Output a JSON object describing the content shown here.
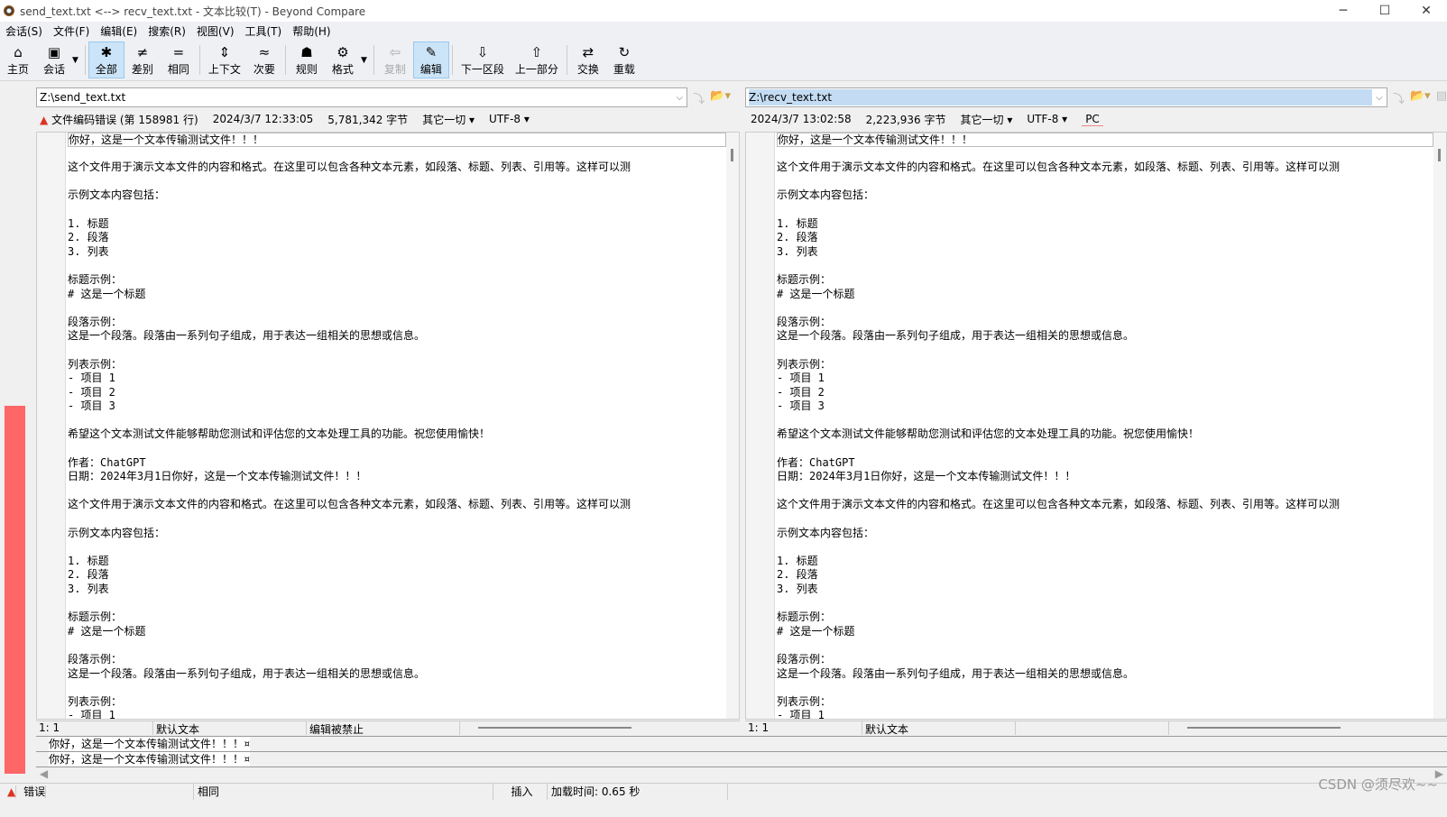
{
  "window": {
    "title": "send_text.txt <--> recv_text.txt - 文本比较(T) - Beyond Compare",
    "minimize": "─",
    "maximize": "☐",
    "close": "✕"
  },
  "menu": [
    "会话(S)",
    "文件(F)",
    "编辑(E)",
    "搜索(R)",
    "视图(V)",
    "工具(T)",
    "帮助(H)"
  ],
  "toolbar": [
    {
      "label": "主页",
      "icon": "⌂"
    },
    {
      "label": "会话",
      "icon": "▣"
    },
    {
      "label": "全部",
      "icon": "✱"
    },
    {
      "label": "差别",
      "icon": "≠"
    },
    {
      "label": "相同",
      "icon": "="
    },
    {
      "label": "上下文",
      "icon": "⇕"
    },
    {
      "label": "次要",
      "icon": "≈"
    },
    {
      "label": "规则",
      "icon": "☗"
    },
    {
      "label": "格式",
      "icon": "⚙"
    },
    {
      "label": "复制",
      "icon": "⇦"
    },
    {
      "label": "编辑",
      "icon": "✎"
    },
    {
      "label": "下一区段",
      "icon": "⇩"
    },
    {
      "label": "上一部分",
      "icon": "⇧"
    },
    {
      "label": "交换",
      "icon": "⇄"
    },
    {
      "label": "重载",
      "icon": "↻"
    }
  ],
  "left": {
    "path": "Z:\\send_text.txt",
    "error": "文件编码错误 (第 158981 行)",
    "date": "2024/3/7 12:33:05",
    "size": "5,781,342 字节",
    "filter": "其它一切",
    "encoding": "UTF-8",
    "status_pos": "1: 1",
    "status_format": "默认文本",
    "status_edit": "编辑被禁止"
  },
  "right": {
    "path": "Z:\\recv_text.txt",
    "date": "2024/3/7 13:02:58",
    "size": "2,223,936 字节",
    "filter": "其它一切",
    "encoding": "UTF-8",
    "lineend": "PC",
    "status_pos": "1: 1",
    "status_format": "默认文本"
  },
  "lines": [
    "你好，这是一个文本传输测试文件！！！",
    "",
    "这个文件用于演示文本文件的内容和格式。在这里可以包含各种文本元素，如段落、标题、列表、引用等。这样可以测",
    "",
    "示例文本内容包括：",
    "",
    "1. 标题",
    "2. 段落",
    "3. 列表",
    "",
    "标题示例：",
    "# 这是一个标题",
    "",
    "段落示例：",
    "这是一个段落。段落由一系列句子组成，用于表达一组相关的思想或信息。",
    "",
    "列表示例：",
    "- 项目 1",
    "- 项目 2",
    "- 项目 3",
    "",
    "希望这个文本测试文件能够帮助您测试和评估您的文本处理工具的功能。祝您使用愉快！",
    "",
    "作者：ChatGPT",
    "日期：2024年3月1日你好，这是一个文本传输测试文件！！！",
    "",
    "这个文件用于演示文本文件的内容和格式。在这里可以包含各种文本元素，如段落、标题、列表、引用等。这样可以测",
    "",
    "示例文本内容包括：",
    "",
    "1. 标题",
    "2. 段落",
    "3. 列表",
    "",
    "标题示例：",
    "# 这是一个标题",
    "",
    "段落示例：",
    "这是一个段落。段落由一系列句子组成，用于表达一组相关的思想或信息。",
    "",
    "列表示例：",
    "- 项目 1"
  ],
  "detail": {
    "left_line": "你好，这是一个文本传输测试文件！！！¤",
    "right_line": "你好，这是一个文本传输测试文件！！！¤"
  },
  "statusbar": {
    "error": "错误",
    "same": "相同",
    "mode": "插入",
    "load_time": "加载时间:  0.65 秒"
  },
  "watermark": "CSDN @须尽欢~~"
}
